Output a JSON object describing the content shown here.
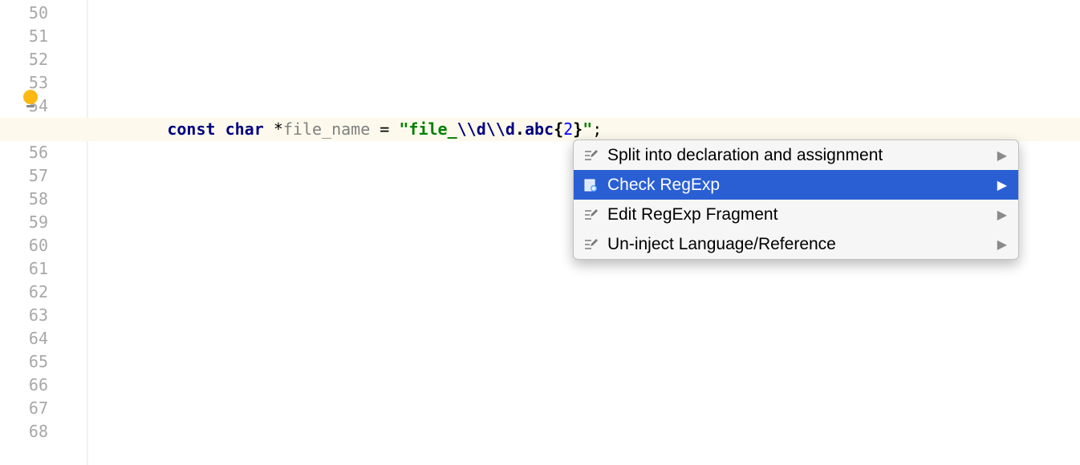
{
  "gutter": {
    "start": 50,
    "end": 68
  },
  "highlighted_line": 55,
  "code": {
    "indent": "        ",
    "kw_const": "const",
    "sp1": " ",
    "kw_char": "char",
    "sp2": " ",
    "star": "*",
    "identifier": "file_name",
    "sp3": " ",
    "equals": "=",
    "sp4": " ",
    "q1": "\"",
    "lit1": "file_",
    "esc1": "\\\\d",
    "esc2": "\\\\d",
    "dot": ".",
    "lit2": "abc",
    "brace1": "{",
    "num": "2",
    "brace2": "}",
    "q2": "\"",
    "semi": ";"
  },
  "menu": {
    "items": [
      {
        "label": "Split into declaration and assignment",
        "icon": "pencil",
        "selected": false,
        "submenu": true
      },
      {
        "label": "Check RegExp",
        "icon": "regexp",
        "selected": true,
        "submenu": true
      },
      {
        "label": "Edit RegExp Fragment",
        "icon": "pencil",
        "selected": false,
        "submenu": true
      },
      {
        "label": "Un-inject Language/Reference",
        "icon": "pencil",
        "selected": false,
        "submenu": true
      }
    ]
  }
}
